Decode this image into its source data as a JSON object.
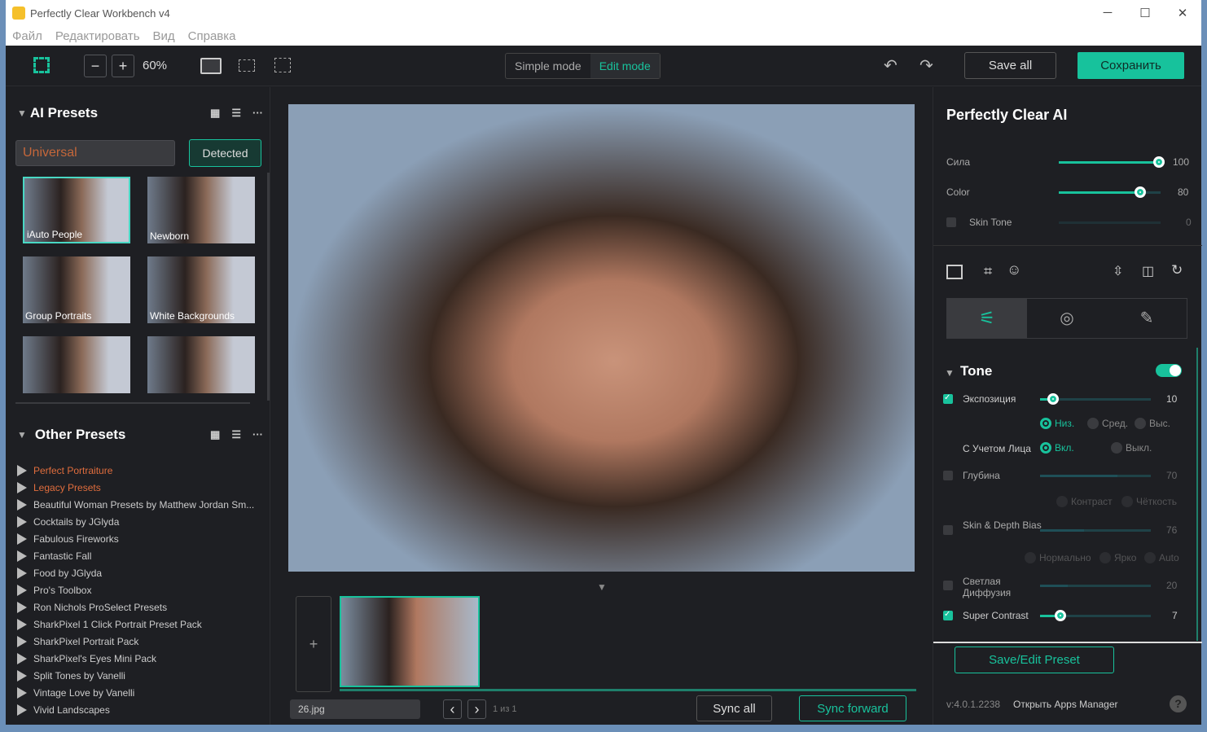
{
  "window": {
    "title": "Perfectly Clear Workbench v4",
    "minimize": "─",
    "maximize": "☐",
    "close": "✕"
  },
  "menu": [
    "Файл",
    "Редактировать",
    "Вид",
    "Справка"
  ],
  "toolbar": {
    "zoom_out": "−",
    "zoom_in": "+",
    "zoom": "60%",
    "simple_mode": "Simple mode",
    "edit_mode": "Edit mode",
    "undo": "↶",
    "redo": "↷",
    "save_all": "Save all",
    "save": "Сохранить"
  },
  "ai_presets": {
    "title": "AI Presets",
    "category": "Universal",
    "detected": "Detected",
    "thumbs": [
      "iAuto People",
      "Newborn",
      "Group Portraits",
      "White Backgrounds",
      "",
      ""
    ]
  },
  "other_presets": {
    "title": "Other Presets",
    "items": [
      {
        "label": "Perfect Portraiture",
        "highlight": true
      },
      {
        "label": "Legacy Presets",
        "highlight": true
      },
      {
        "label": "Beautiful Woman Presets by Matthew Jordan Sm..."
      },
      {
        "label": "Cocktails by JGlyda"
      },
      {
        "label": "Fabulous Fireworks"
      },
      {
        "label": "Fantastic Fall"
      },
      {
        "label": "Food by JGlyda"
      },
      {
        "label": "Pro's Toolbox"
      },
      {
        "label": "Ron Nichols ProSelect Presets"
      },
      {
        "label": "SharkPixel 1 Click Portrait Preset Pack"
      },
      {
        "label": "SharkPixel Portrait Pack"
      },
      {
        "label": "SharkPixel's Eyes Mini Pack"
      },
      {
        "label": "Split Tones by Vanelli"
      },
      {
        "label": "Vintage Love by Vanelli"
      },
      {
        "label": "Vivid Landscapes"
      }
    ]
  },
  "filmstrip": {
    "add": "+",
    "file": "26.jpg",
    "prev": "‹",
    "next": "›",
    "page": "1 из 1",
    "sync_all": "Sync all",
    "sync_forward": "Sync forward"
  },
  "right": {
    "title": "Perfectly Clear AI",
    "strength": {
      "label": "Сила",
      "value": 100
    },
    "color": {
      "label": "Color",
      "value": 80
    },
    "skin_tone": {
      "label": "Skin Tone",
      "value": 0,
      "checked": false
    },
    "tone": {
      "title": "Tone",
      "enabled": true,
      "exposure": {
        "label": "Экспозиция",
        "value": 10,
        "checked": true,
        "levels": [
          "Низ.",
          "Сред.",
          "Выс."
        ],
        "selected": "Низ."
      },
      "face": {
        "label": "С Учетом Лица",
        "on": "Вкл.",
        "off": "Выкл.",
        "selected": "Вкл."
      },
      "depth": {
        "label": "Глубина",
        "value": 70,
        "checked": false,
        "modes": [
          "Контраст",
          "Чёткость"
        ]
      },
      "skin_depth": {
        "label": "Skin & Depth Bias",
        "value": 76,
        "checked": false,
        "modes": [
          "Нормально",
          "Ярко",
          "Auto"
        ]
      },
      "light_diffusion": {
        "label": "Светлая Диффузия",
        "value": 20,
        "checked": false
      },
      "super_contrast": {
        "label": "Super Contrast",
        "value": 7,
        "checked": true
      }
    },
    "save_preset": "Save/Edit Preset",
    "version": "v:4.0.1.2238",
    "apps_manager": "Открыть Apps Manager",
    "help": "?"
  },
  "colors": {
    "accent": "#18c29c",
    "highlight": "#e06d3d"
  }
}
